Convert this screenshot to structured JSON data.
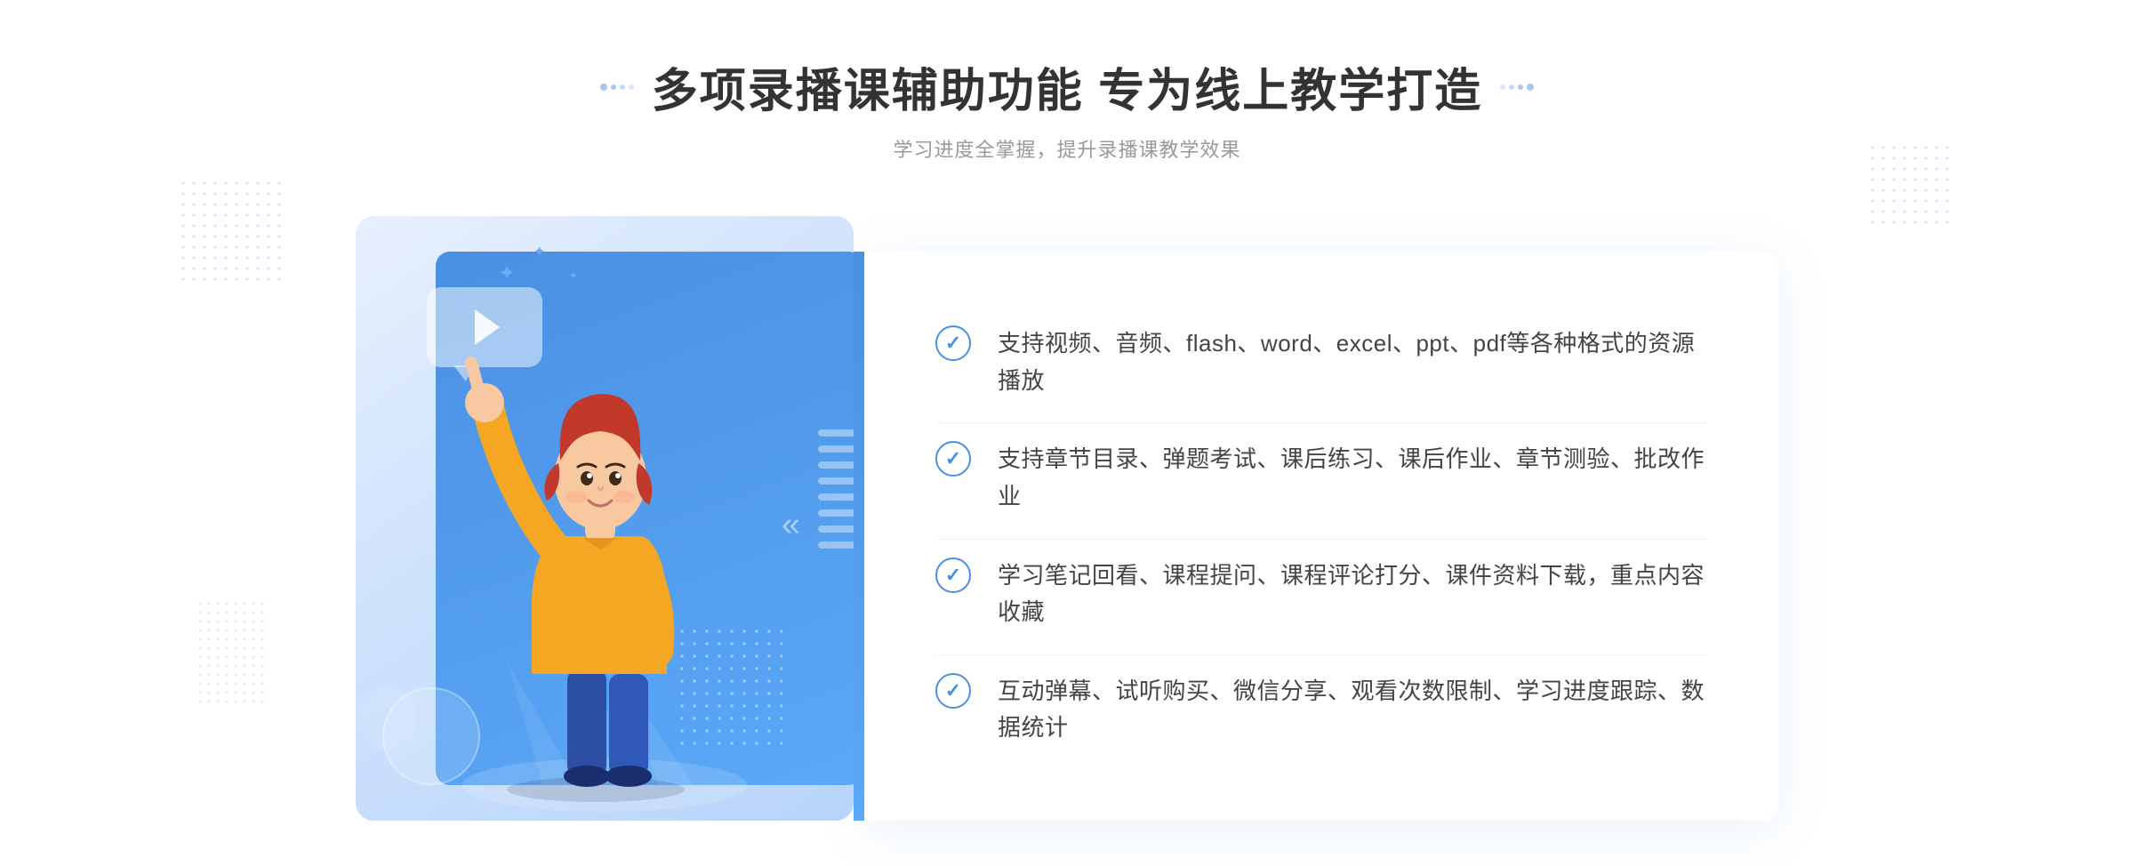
{
  "header": {
    "title": "多项录播课辅助功能 专为线上教学打造",
    "subtitle": "学习进度全掌握，提升录播课教学效果",
    "title_dots_left": [
      "●",
      "●"
    ],
    "title_dots_right": [
      "●",
      "●"
    ]
  },
  "features": [
    {
      "id": 1,
      "text": "支持视频、音频、flash、word、excel、ppt、pdf等各种格式的资源播放"
    },
    {
      "id": 2,
      "text": "支持章节目录、弹题考试、课后练习、课后作业、章节测验、批改作业"
    },
    {
      "id": 3,
      "text": "学习笔记回看、课程提问、课程评论打分、课件资料下载，重点内容收藏"
    },
    {
      "id": 4,
      "text": "互动弹幕、试听购买、微信分享、观看次数限制、学习进度跟踪、数据统计"
    }
  ],
  "colors": {
    "primary": "#4a90e2",
    "title": "#333333",
    "subtitle": "#999999",
    "feature_text": "#444444",
    "accent": "#5ba8f8"
  },
  "chevron_left": "»",
  "play_icon": "▶"
}
